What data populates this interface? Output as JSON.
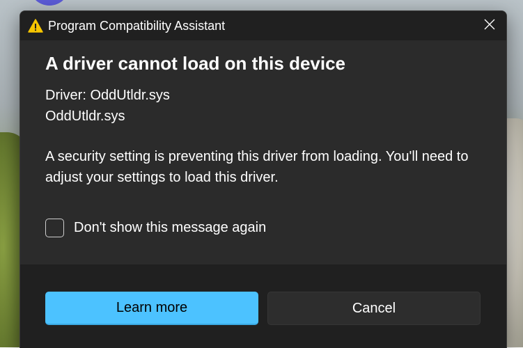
{
  "window": {
    "title": "Program Compatibility Assistant",
    "title_icon": "warning-icon",
    "close_icon": "close-icon"
  },
  "content": {
    "heading": "A driver cannot load on this device",
    "driver_label": "Driver: OddUtldr.sys",
    "driver_file": "OddUtldr.sys",
    "message": "A security setting is preventing this driver from loading. You'll need to adjust your settings to load this driver.",
    "checkbox_label": "Don't show this message again",
    "checkbox_checked": false
  },
  "footer": {
    "primary_label": "Learn more",
    "secondary_label": "Cancel"
  },
  "colors": {
    "accent": "#4cc2ff",
    "dialog_bg": "#2b2b2b",
    "titlebar_bg": "#202020",
    "warning": "#f7c600"
  }
}
